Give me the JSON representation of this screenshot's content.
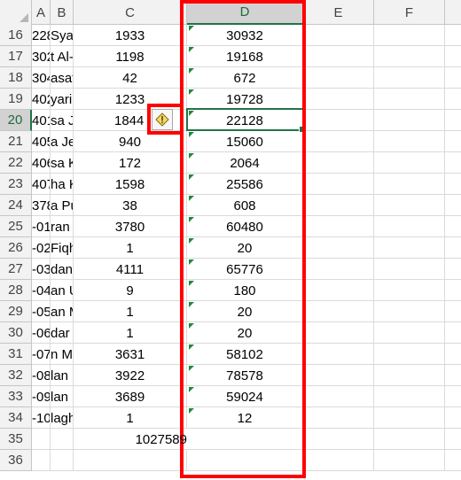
{
  "columns": [
    "A",
    "B",
    "C",
    "D",
    "E",
    "F"
  ],
  "rows": [
    {
      "num": "16",
      "a": "228",
      "b": "Syar",
      "c": "1933",
      "d": "30932"
    },
    {
      "num": "17",
      "a": "302",
      "b": "t Al-",
      "c": "1198",
      "d": "19168"
    },
    {
      "num": "18",
      "a": "304",
      "b": "asat",
      "c": "42",
      "d": "672"
    },
    {
      "num": "19",
      "a": "402",
      "b": "yari",
      "c": "1233",
      "d": "19728"
    },
    {
      "num": "20",
      "a": "401",
      "b": "sa J",
      "c": "1844",
      "d": "22128"
    },
    {
      "num": "21",
      "a": "405",
      "b": "a Je",
      "c": "940",
      "d": "15060"
    },
    {
      "num": "22",
      "a": "406",
      "b": "sa K",
      "c": "172",
      "d": "2064"
    },
    {
      "num": "23",
      "a": "407",
      "b": "ha K",
      "c": "1598",
      "d": "25586"
    },
    {
      "num": "24",
      "a": "378",
      "b": "a Pu",
      "c": "38",
      "d": "608"
    },
    {
      "num": "25",
      "a": "01-",
      "b": "ran",
      "c": "3780",
      "d": "60480"
    },
    {
      "num": "26",
      "a": "02-",
      "b": "Fiqh",
      "c": "1",
      "d": "20"
    },
    {
      "num": "27",
      "a": "03-",
      "b": "dan",
      "c": "4111",
      "d": "65776"
    },
    {
      "num": "28",
      "a": "04-",
      "b": "an U",
      "c": "9",
      "d": "180"
    },
    {
      "num": "29",
      "a": "05-",
      "b": "an M",
      "c": "1",
      "d": "20"
    },
    {
      "num": "30",
      "a": "06-",
      "b": "dar",
      "c": "1",
      "d": "20"
    },
    {
      "num": "31",
      "a": "07-",
      "b": "n M",
      "c": "3631",
      "d": "58102"
    },
    {
      "num": "32",
      "a": "08-",
      "b": "lan",
      "c": "3922",
      "d": "78578"
    },
    {
      "num": "33",
      "a": "09-",
      "b": "lan",
      "c": "3689",
      "d": "59024"
    },
    {
      "num": "34",
      "a": "10-",
      "b": "lagh",
      "c": "1",
      "d": "12"
    },
    {
      "num": "35",
      "a": "",
      "b": "",
      "c": "1027589",
      "d": ""
    },
    {
      "num": "36",
      "a": "",
      "b": "",
      "c": "",
      "d": ""
    }
  ],
  "active_row": "20",
  "active_column": "D",
  "colors": {
    "accent": "#217346",
    "highlight": "#ff0000",
    "error_marker": "#1e8a3c"
  },
  "icons": {
    "warning": "warning-icon"
  }
}
